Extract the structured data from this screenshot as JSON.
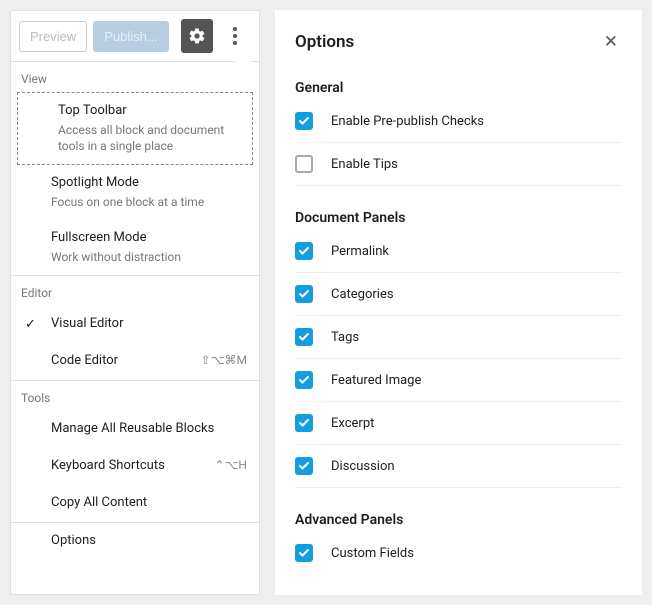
{
  "toolbar": {
    "preview": "Preview",
    "publish": "Publish..."
  },
  "dropdown": {
    "sections": {
      "view": {
        "label": "View",
        "items": [
          {
            "title": "Top Toolbar",
            "desc": "Access all block and document tools in a single place"
          },
          {
            "title": "Spotlight Mode",
            "desc": "Focus on one block at a time"
          },
          {
            "title": "Fullscreen Mode",
            "desc": "Work without distraction"
          }
        ]
      },
      "editor": {
        "label": "Editor",
        "items": [
          {
            "title": "Visual Editor",
            "checked": true
          },
          {
            "title": "Code Editor",
            "shortcut": "⇧⌥⌘M"
          }
        ]
      },
      "tools": {
        "label": "Tools",
        "items": [
          {
            "title": "Manage All Reusable Blocks"
          },
          {
            "title": "Keyboard Shortcuts",
            "shortcut": "⌃⌥H"
          },
          {
            "title": "Copy All Content"
          },
          {
            "title": "Options"
          }
        ]
      }
    }
  },
  "options": {
    "title": "Options",
    "groups": [
      {
        "title": "General",
        "items": [
          {
            "label": "Enable Pre-publish Checks",
            "checked": true
          },
          {
            "label": "Enable Tips",
            "checked": false
          }
        ]
      },
      {
        "title": "Document Panels",
        "items": [
          {
            "label": "Permalink",
            "checked": true
          },
          {
            "label": "Categories",
            "checked": true
          },
          {
            "label": "Tags",
            "checked": true
          },
          {
            "label": "Featured Image",
            "checked": true
          },
          {
            "label": "Excerpt",
            "checked": true
          },
          {
            "label": "Discussion",
            "checked": true
          }
        ]
      },
      {
        "title": "Advanced Panels",
        "items": [
          {
            "label": "Custom Fields",
            "checked": true
          }
        ]
      }
    ]
  }
}
